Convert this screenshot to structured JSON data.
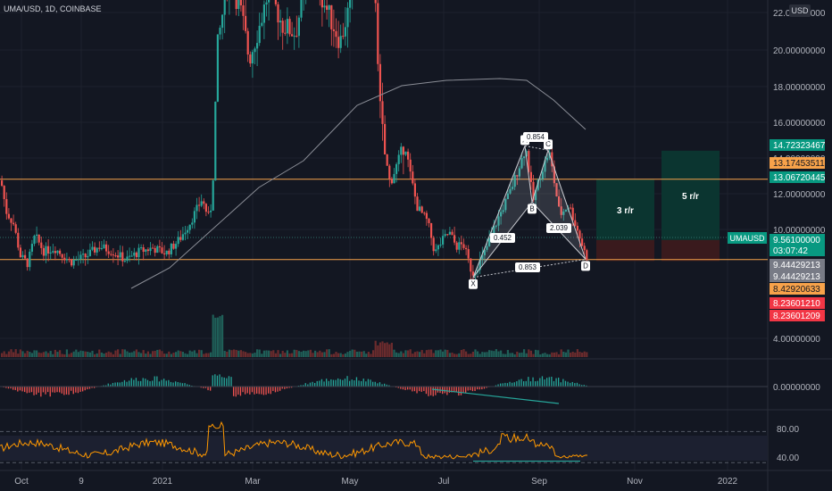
{
  "header": {
    "symbol": "UMA/USD, 1D, COINBASE",
    "currency": "USD"
  },
  "colors": {
    "bg": "#131722",
    "up": "#26a69a",
    "down": "#ef5350",
    "grid": "#1e222d",
    "axis_text": "#b2b5be",
    "orange": "#f7a24a",
    "rsi": "#ff9800",
    "green_badge": "#089981",
    "red_badge": "#f23645",
    "gray_badge": "#787b86",
    "orange_badge": "#f7a24a",
    "teal_zone": "#0b3530",
    "red_zone": "#3a1a1d"
  },
  "chart_data": {
    "type": "candlestick",
    "x": {
      "tick_labels": [
        "Oct",
        "9",
        "2021",
        "Mar",
        "May",
        "Jul",
        "Sep",
        "Nov",
        "2022"
      ]
    },
    "y": {
      "range": [
        2.9,
        22.6
      ],
      "tick_labels": [
        "22.00000000",
        "20.00000000",
        "18.00000000",
        "16.00000000",
        "14.00000000",
        "12.00000000",
        "10.00000000",
        "4.00000000"
      ]
    },
    "horizontal_lines": [
      13.07,
      8.43
    ],
    "moving_average_peak": 18.45,
    "harmonic_pattern": {
      "points": [
        {
          "label": "X",
          "value": 7.4
        },
        {
          "label": "A",
          "value": 15.0
        },
        {
          "label": "B",
          "value": 11.75
        },
        {
          "label": "C",
          "value": 14.75
        },
        {
          "label": "D",
          "value": 8.45
        }
      ],
      "ratios": [
        "0.854",
        "0.452",
        "2.039",
        "0.853"
      ]
    },
    "risk_reward_boxes": [
      {
        "label": "3 r/r",
        "target": 13.07,
        "entry": 9.56,
        "stop": 8.45
      },
      {
        "label": "5 r/r",
        "target": 14.72,
        "entry": 9.56,
        "stop": 8.45
      }
    ],
    "price_labels": [
      {
        "text": "14.72323467",
        "color": "green"
      },
      {
        "text": "13.17453511",
        "color": "orange"
      },
      {
        "text": "13.06720445",
        "color": "green"
      },
      {
        "text": "9.56100000",
        "color": "green"
      },
      {
        "text": "03:07:42",
        "color": "green"
      },
      {
        "text": "9.44429213",
        "color": "gray"
      },
      {
        "text": "9.44429213",
        "color": "gray"
      },
      {
        "text": "8.42920633",
        "color": "orange"
      },
      {
        "text": "8.23601210",
        "color": "red"
      },
      {
        "text": "8.23601209",
        "color": "red"
      }
    ],
    "symbol_tag": "UMAUSD",
    "oscillator": {
      "zero_label": "0.00000000"
    },
    "rsi": {
      "tick_labels": [
        "80.00",
        "40.00"
      ],
      "levels": [
        70,
        30
      ]
    }
  }
}
